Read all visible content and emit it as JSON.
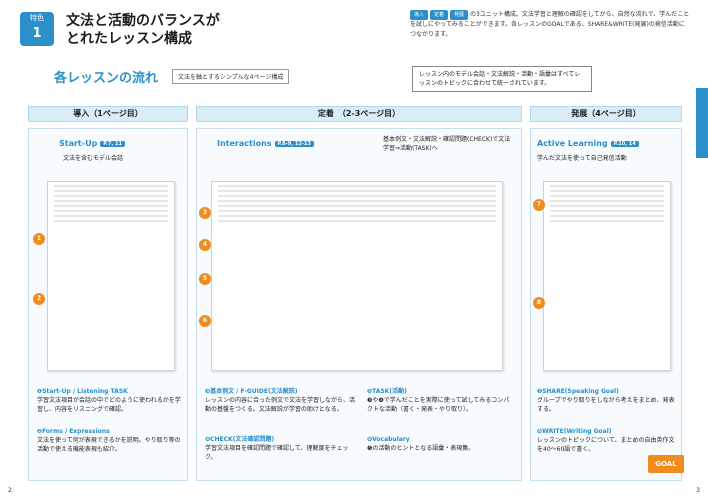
{
  "header": {
    "badge_small": "特色",
    "badge_num": "1",
    "title_line1": "文法と活動のバランスが",
    "title_line2": "とれたレッスン構成",
    "chip1": "導入",
    "chip2": "定着",
    "chip3": "発展",
    "description": "の3ユニット構成。文法学習と理解の確認をしてから、自然な流れで、学んだことを試しにやってみることができます。各レッスンのGOALである、SHARE&WRITE(発展)の発信活動につながります。"
  },
  "section": {
    "title": "各レッスンの流れ",
    "subtitle": "文法を軸とするシンプルな4ページ構成",
    "callout": "レッスン内のモデル会話・文法解説・活動・語彙はすべてレッスンのトピックに合わせて統一されています。"
  },
  "stages": [
    {
      "label": "導入（1ページ目）"
    },
    {
      "label": "定着　（2-3ページ目）"
    },
    {
      "label": "発展（4ページ目）"
    }
  ],
  "columns": {
    "c1": {
      "head": "Start-Up",
      "tag": "P.7, 11",
      "sub": "文法を含むモデル会話"
    },
    "c2": {
      "head": "Interactions",
      "tag": "P.8-9, 12-13",
      "sub": "基本例文・文法解説・確認問題(CHECK)で文法学習⇒活動(TASK)へ"
    },
    "c3": {
      "head": "Active Learning",
      "tag": "P.10, 14",
      "sub": "学んだ文法を使って自己発信活動"
    }
  },
  "descriptions": {
    "d1": {
      "title": "❶Start-Up / Listening TASK",
      "body": "学習文法項目が会話の中でどのように使われるかを学習し、内容をリスニングで確認。"
    },
    "d2": {
      "title": "❷Forms / Expressions",
      "body": "文法を使って何が表現できるかを説明。やり取り等の活動で使える機能表現も紹介。"
    },
    "d3": {
      "title": "❸基本例文 / F-GUIDE(文法解説)",
      "body": "レッスンの内容に合った例文で文法を学習しながら、活動の基盤をつくる。文法解説が学習の助けとなる。"
    },
    "d4": {
      "title": "❹CHECK(文法確認問題)",
      "body": "学習文法項目を確認問題で確認して、理解度をチェック。"
    },
    "d5": {
      "title": "❺TASK(活動)",
      "body": "❸や❹で学んだことを実際に使って試してみるコンパクトな活動（書く・発表・やり取り）。"
    },
    "d6": {
      "title": "❻Vocabulary",
      "body": "❺の活動のヒントとなる語彙・表現集。"
    },
    "d7": {
      "title": "❼SHARE(Speaking Goal)",
      "body": "グループでやり取りをしながら考えをまとめ、発表する。"
    },
    "d8": {
      "title": "❽WRITE(Writing Goal)",
      "body": "レッスンのトピックについて、まとめの自由英作文を40～60語で書く。"
    }
  },
  "markers": [
    "1",
    "2",
    "3",
    "4",
    "5",
    "6",
    "7",
    "8"
  ],
  "goal_label": "GOAL",
  "page_left": "2",
  "page_right": "3",
  "colors": {
    "accent": "#2b8fc9",
    "orange": "#f08c1e"
  }
}
